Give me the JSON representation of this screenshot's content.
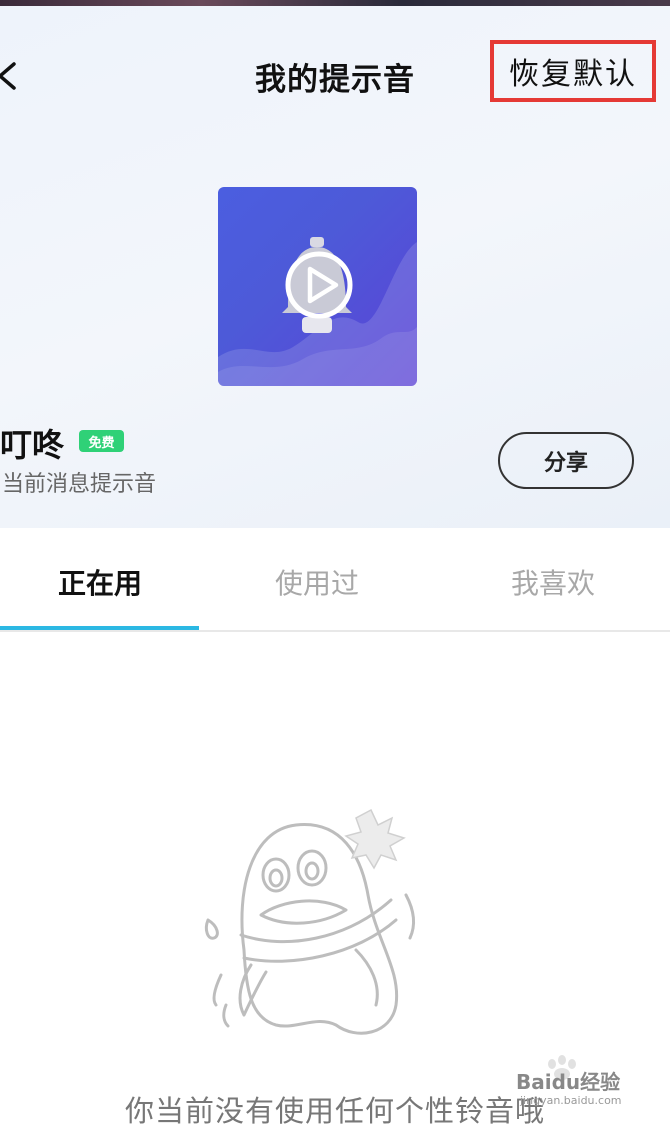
{
  "header": {
    "title": "我的提示音",
    "restore_label": "恢复默认"
  },
  "current_tone": {
    "name": "叮咚",
    "badge": "免费",
    "subtitle": "当前消息提示音",
    "share_label": "分享"
  },
  "tabs": [
    {
      "label": "正在用",
      "active": true
    },
    {
      "label": "使用过",
      "active": false
    },
    {
      "label": "我喜欢",
      "active": false
    }
  ],
  "empty_state": {
    "message": "你当前没有使用任何个性铃音哦"
  },
  "watermark": {
    "text": "Baidu经验",
    "sub": "jingyan.baidu.com"
  },
  "colors": {
    "accent": "#2bb8e3",
    "badge_green": "#2fd177",
    "highlight_red": "#e53935"
  }
}
